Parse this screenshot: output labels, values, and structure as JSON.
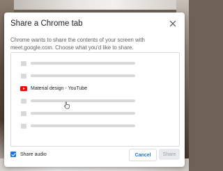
{
  "dialog": {
    "title": "Share a Chrome tab",
    "subtitle": "Chrome wants to share the contents of your screen with meet.google.com. Choose what you'd like to share.",
    "close_icon": "close-icon"
  },
  "tabs": [
    {
      "type": "placeholder"
    },
    {
      "type": "placeholder"
    },
    {
      "type": "tab",
      "label": "Material design - YouTube",
      "icon": "youtube-icon"
    },
    {
      "type": "placeholder"
    },
    {
      "type": "placeholder"
    },
    {
      "type": "placeholder"
    }
  ],
  "share_audio": {
    "label": "Share audio",
    "checked": true
  },
  "buttons": {
    "cancel": "Cancel",
    "share": "Share"
  },
  "colors": {
    "accent": "#1a73e8",
    "youtube_red": "#ff0000"
  }
}
